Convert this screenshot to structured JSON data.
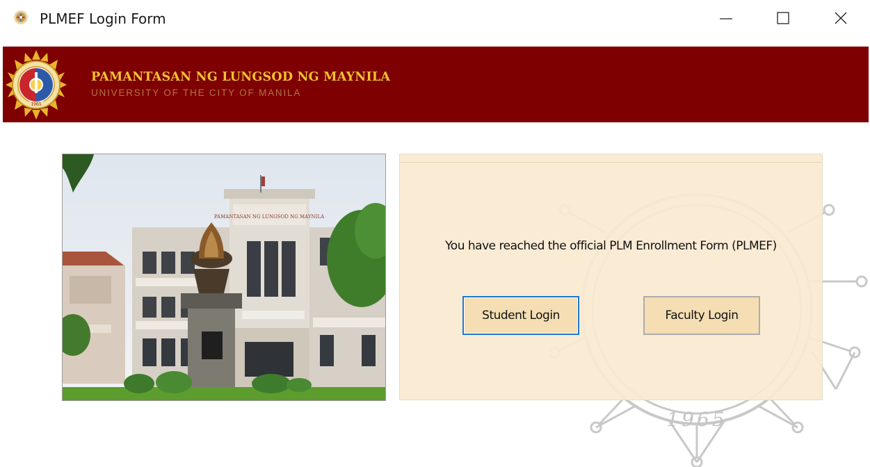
{
  "window": {
    "title": "PLMEF Login Form",
    "controls": {
      "minimize": "minimize-icon",
      "maximize": "maximize-icon",
      "close": "close-icon"
    }
  },
  "header": {
    "university_name": "PAMANTASAN NG LUNGSOD NG MAYNILA",
    "university_subtitle": "UNIVERSITY OF THE CITY OF MANILA",
    "seal_year": "1965",
    "banner_color": "#7f0000",
    "name_color": "#f2c233"
  },
  "watermark": {
    "year": "1965"
  },
  "photo": {
    "sign_text": "PAMANTASAN NG LUNGSOD NG MAYNILA"
  },
  "login_panel": {
    "message": "You have reached the official PLM Enrollment Form (PLMEF)",
    "student_button": "Student Login",
    "faculty_button": "Faculty Login",
    "button_color": "#f5deb3",
    "focus_color": "#1a78d4"
  }
}
